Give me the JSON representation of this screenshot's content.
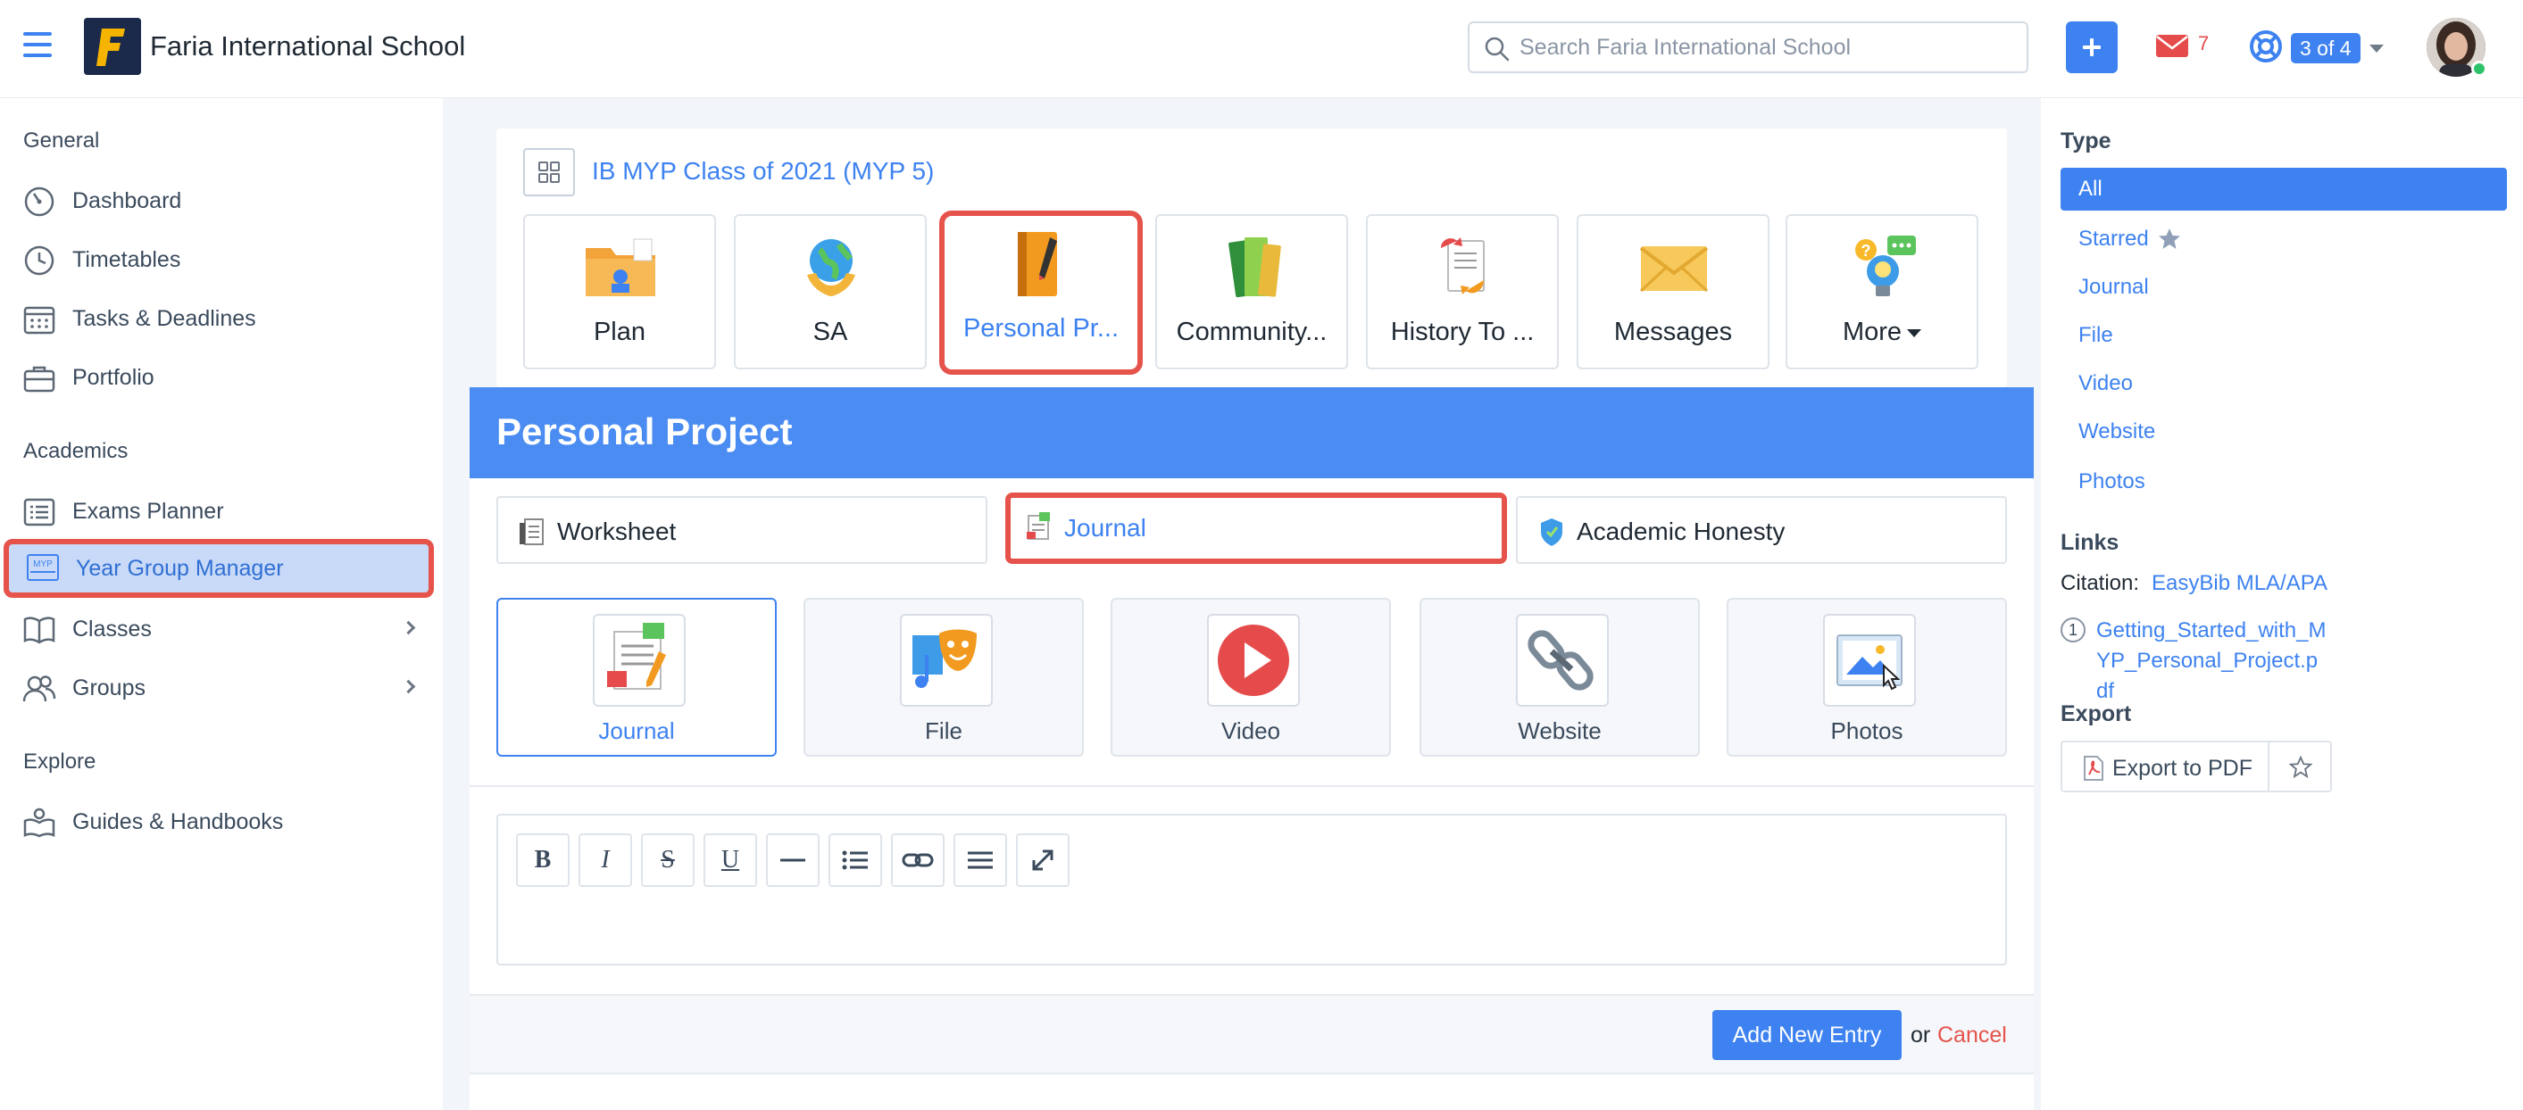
{
  "header": {
    "school_name": "Faria International School",
    "logo_letter": "F",
    "search_placeholder": "Search Faria International School",
    "mail_count": "7",
    "pager": "3 of 4"
  },
  "sidebar": {
    "general_title": "General",
    "general_items": [
      {
        "label": "Dashboard",
        "icon": "dashboard-icon"
      },
      {
        "label": "Timetables",
        "icon": "clock-icon"
      },
      {
        "label": "Tasks & Deadlines",
        "icon": "calendar-icon"
      },
      {
        "label": "Portfolio",
        "icon": "briefcase-icon"
      }
    ],
    "academics_title": "Academics",
    "academics_items": [
      {
        "label": "Exams Planner",
        "icon": "list-icon"
      },
      {
        "label": "Year Group Manager",
        "icon": "myp-icon",
        "active": true
      },
      {
        "label": "Classes",
        "icon": "book-icon"
      },
      {
        "label": "Groups",
        "icon": "people-icon"
      }
    ],
    "explore_title": "Explore",
    "explore_items": [
      {
        "label": "Guides & Handbooks",
        "icon": "reader-icon"
      }
    ],
    "myp_badge": "MYP"
  },
  "class": {
    "title": "IB MYP Class of 2021 (MYP 5)",
    "tiles": [
      {
        "label": "Plan",
        "icon": "folder-icon"
      },
      {
        "label": "SA",
        "icon": "globe-icon"
      },
      {
        "label": "Personal Pr...",
        "icon": "notebook-icon",
        "selected": true
      },
      {
        "label": "Community...",
        "icon": "books-icon"
      },
      {
        "label": "History To ...",
        "icon": "document-icon"
      },
      {
        "label": "Messages",
        "icon": "envelope-icon"
      },
      {
        "label": "More",
        "icon": "lightbulb-icon"
      }
    ]
  },
  "project": {
    "title": "Personal Project",
    "subtabs": [
      {
        "label": "Worksheet",
        "icon": "worksheet-icon"
      },
      {
        "label": "Journal",
        "icon": "journal-icon",
        "selected": true
      },
      {
        "label": "Academic Honesty",
        "icon": "shield-icon"
      }
    ],
    "entry_types": [
      {
        "label": "Journal",
        "icon": "journal-entry-icon",
        "selected": true
      },
      {
        "label": "File",
        "icon": "music-theatre-icon"
      },
      {
        "label": "Video",
        "icon": "play-icon"
      },
      {
        "label": "Website",
        "icon": "chain-link-icon"
      },
      {
        "label": "Photos",
        "icon": "image-icon"
      }
    ],
    "toolbar": [
      "B",
      "I",
      "S",
      "U"
    ],
    "add_label": "Add New Entry",
    "or_label": "or",
    "cancel_label": "Cancel"
  },
  "right_panel": {
    "type_title": "Type",
    "types": [
      "All",
      "Starred",
      "Journal",
      "File",
      "Video",
      "Website",
      "Photos"
    ],
    "links_title": "Links",
    "citation_label": "Citation:",
    "citation_link": "EasyBib MLA/APA",
    "file_number": "1",
    "file_link": "Getting_Started_with_MYP_Personal_Project.pdf",
    "export_title": "Export",
    "export_label": "Export to PDF"
  },
  "colors": {
    "accent": "#3d82f0",
    "highlight": "#e5534b",
    "header_band": "#4a8cf2"
  }
}
